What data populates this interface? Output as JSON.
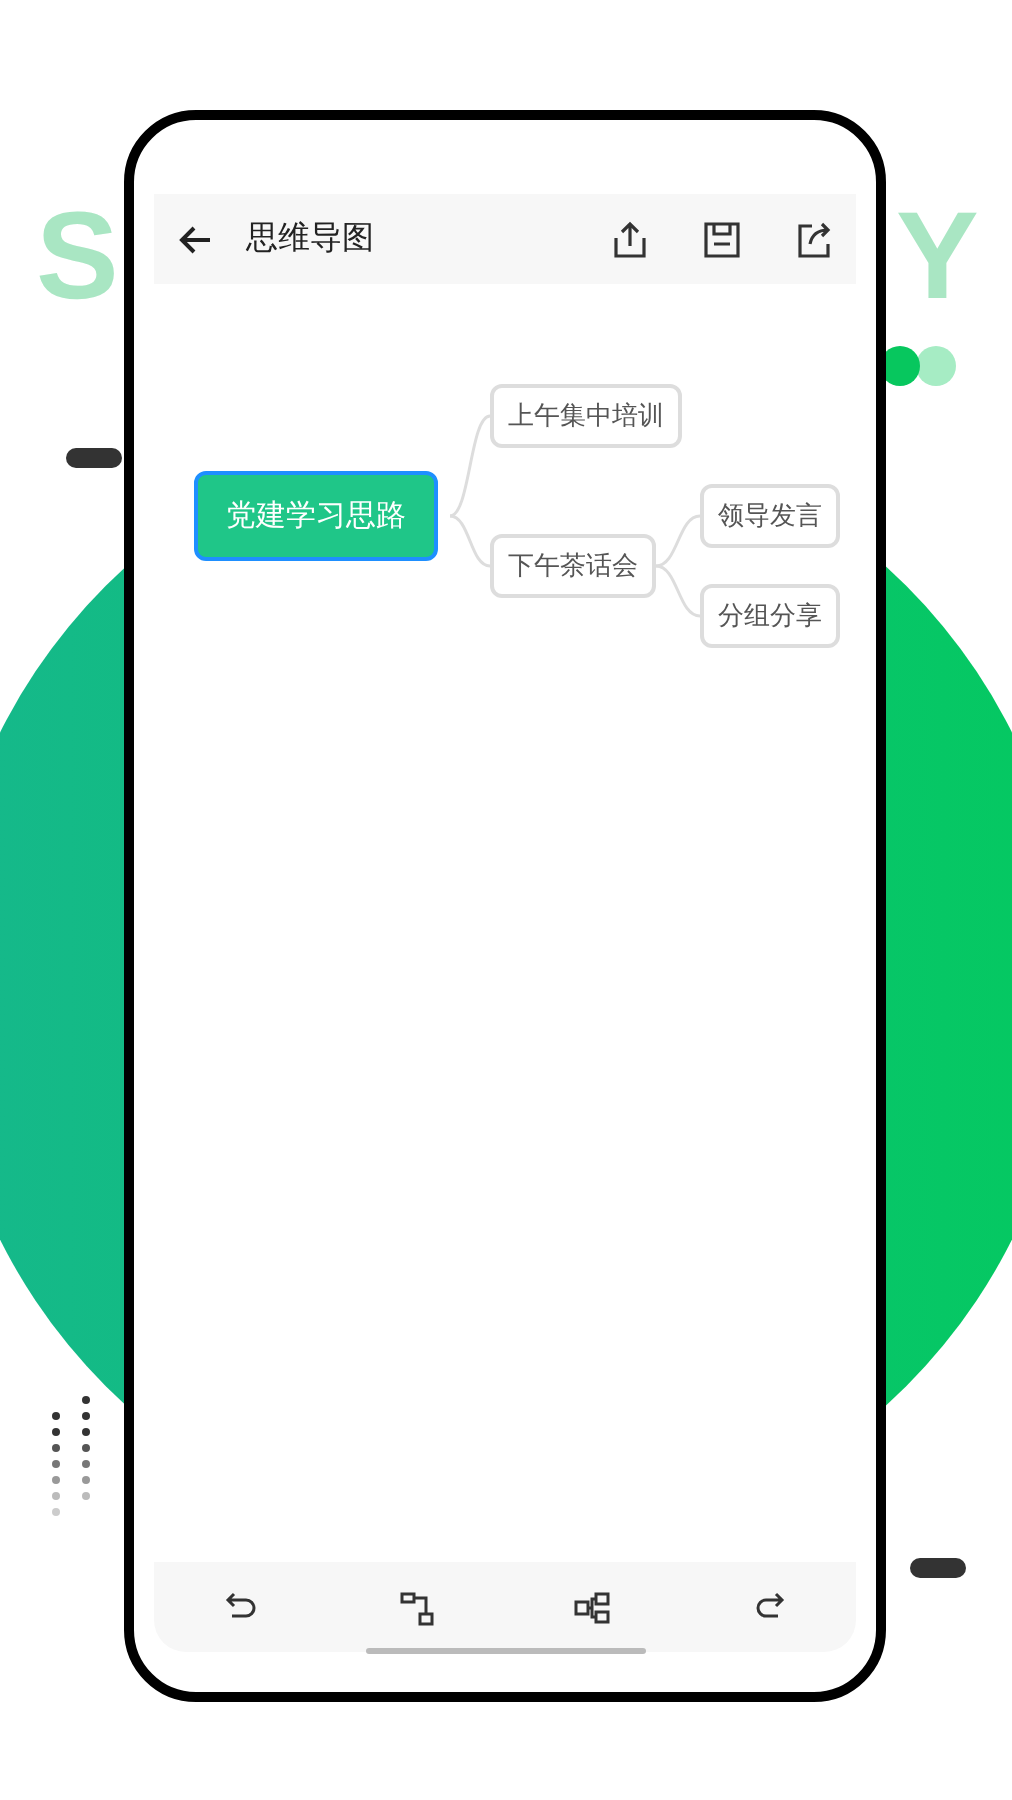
{
  "backdrop_letters": [
    "S",
    "Y"
  ],
  "app_bar": {
    "title": "思维导图"
  },
  "mind_map": {
    "root": {
      "label": "党建学习思路",
      "selected": true,
      "children": [
        {
          "label": "上午集中培训",
          "selected": false
        },
        {
          "label": "下午茶话会",
          "selected": false,
          "children": [
            {
              "label": "领导发言",
              "selected": false
            },
            {
              "label": "分组分享",
              "selected": false
            }
          ]
        }
      ]
    }
  }
}
